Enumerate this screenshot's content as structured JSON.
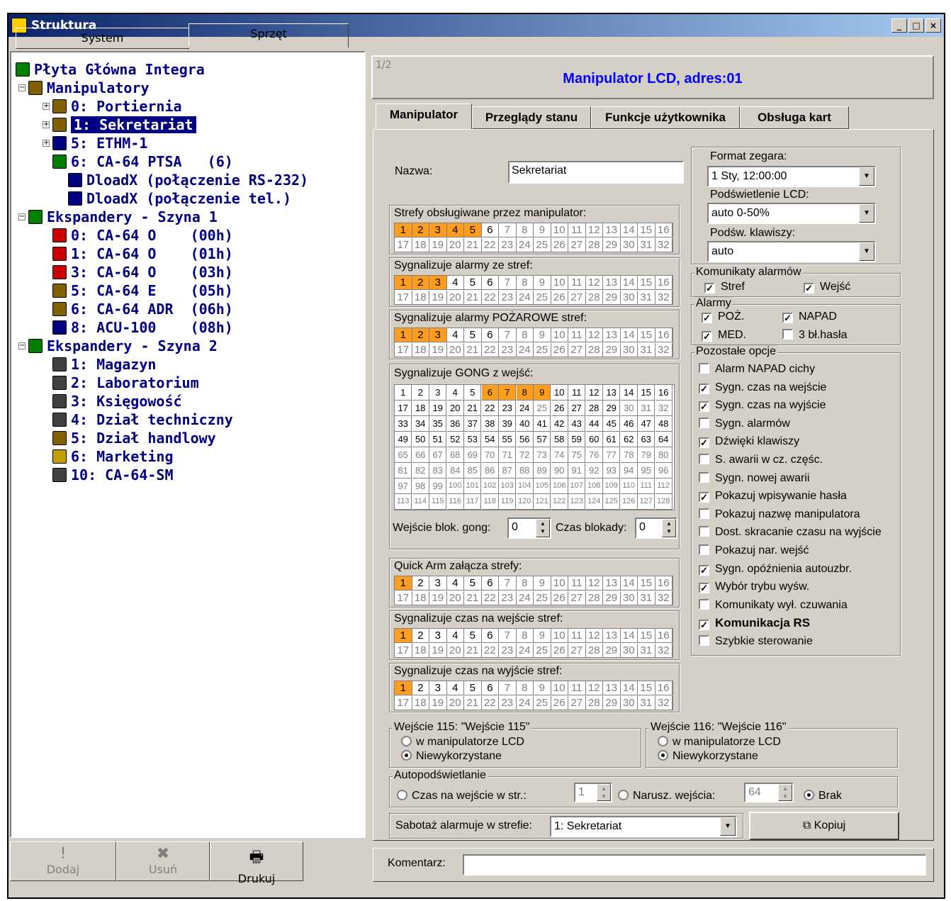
{
  "window": {
    "title": "Struktura",
    "minimize": "_",
    "maximize": "□",
    "close": "×"
  },
  "left_tabs": [
    "System",
    "Sprzęt"
  ],
  "tree": [
    {
      "label": "Płyta Główna Integra",
      "icon": "mainboard-icon"
    },
    {
      "label": "Manipulatory",
      "icon": "keypads-icon"
    },
    {
      "label": "0: Portiernia",
      "icon": "keypad-icon"
    },
    {
      "label": "1: Sekretariat",
      "icon": "keypad-icon"
    },
    {
      "label": "5: ETHM-1",
      "icon": "ethernet-module-icon"
    },
    {
      "label": "6: CA-64 PTSA   (6)",
      "icon": "signal-board-icon"
    },
    {
      "label": "DloadX (połączenie RS-232)",
      "icon": "dloadx-icon"
    },
    {
      "label": "DloadX (połączenie tel.)",
      "icon": "dloadx-icon"
    },
    {
      "label": "Ekspandery - Szyna 1",
      "icon": "expanders-icon"
    },
    {
      "label": "0: CA-64 O    (00h)",
      "icon": "output-expander-icon"
    },
    {
      "label": "1: CA-64 O    (01h)",
      "icon": "output-expander-icon"
    },
    {
      "label": "3: CA-64 O    (03h)",
      "icon": "output-expander-icon"
    },
    {
      "label": "5: CA-64 E    (05h)",
      "icon": "input-expander-icon"
    },
    {
      "label": "6: CA-64 ADR  (06h)",
      "icon": "input-expander-icon"
    },
    {
      "label": "8: ACU-100    (08h)",
      "icon": "wireless-controller-icon"
    },
    {
      "label": "Ekspandery - Szyna 2",
      "icon": "expanders-icon"
    },
    {
      "label": "1: Magazyn",
      "icon": "partition-keypad-icon"
    },
    {
      "label": "2: Laboratorium",
      "icon": "card-reader-icon"
    },
    {
      "label": "3: Księgowość",
      "icon": "partition-keypad-icon"
    },
    {
      "label": "4: Dział techniczny",
      "icon": "card-reader-icon"
    },
    {
      "label": "5: Dział handlowy",
      "icon": "proximity-reader-icon"
    },
    {
      "label": "6: Marketing",
      "icon": "dallas-reader-icon"
    },
    {
      "label": "10: CA-64-SM",
      "icon": "voice-module-icon"
    }
  ],
  "bottom_buttons": {
    "add": "Dodaj",
    "remove": "Usuń",
    "print": "Drukuj"
  },
  "header": {
    "page": "1/2",
    "title": "Manipulator LCD, adres:01"
  },
  "tabs": [
    "Manipulator",
    "Przeglądy stanu",
    "Funkcje użytkownika",
    "Obsługa kart"
  ],
  "form": {
    "name_label": "Nazwa:",
    "name_value": "Sekretariat",
    "zones_handled": {
      "label": "Strefy obsługiwane przez manipulator:",
      "selected": [
        1,
        2,
        3,
        4,
        5
      ],
      "active_max": 6
    },
    "alarms_from": {
      "label": "Sygnalizuje alarmy ze stref:",
      "selected": [
        1,
        2,
        3
      ],
      "active_max": 6
    },
    "fire_alarms": {
      "label": "Sygnalizuje alarmy POŻAROWE stref:",
      "selected": [
        1,
        2,
        3
      ],
      "active_max": 6
    },
    "gong": {
      "label": "Sygnalizuje GONG z wejść:",
      "selected": [
        6,
        7,
        8,
        9
      ]
    },
    "gong_block_label": "Wejście blok. gong:",
    "gong_block_value": "0",
    "block_time_label": "Czas blokady:",
    "block_time_value": "0",
    "quick_arm": {
      "label": "Quick Arm załącza strefy:",
      "selected": [
        1
      ],
      "active_max": 6
    },
    "entry_time": {
      "label": "Sygnalizuje czas na wejście stref:",
      "selected": [
        1
      ],
      "active_max": 6
    },
    "exit_time": {
      "label": "Sygnalizuje czas na wyjście stref:",
      "selected": [
        1
      ],
      "active_max": 6
    },
    "clock_format_label": "Format zegara:",
    "clock_format_value": "1 Sty, 12:00:00",
    "lcd_backlight_label": "Podświetlenie  LCD:",
    "lcd_backlight_value": "auto 0-50%",
    "key_backlight_label": "Podśw. klawiszy:",
    "key_backlight_value": "auto",
    "alarm_messages": {
      "label": "Komunikaty alarmów",
      "stref": "Stref",
      "wejsc": "Wejść"
    },
    "alarms": {
      "label": "Alarmy",
      "poz": "POŻ.",
      "napad": "NAPAD",
      "med": "MED.",
      "hasla": "3 bł.hasła"
    },
    "other_options_label": "Pozostałe opcje",
    "options": [
      {
        "label": "Alarm NAPAD cichy",
        "checked": false
      },
      {
        "label": "Sygn. czas na wejście",
        "checked": true
      },
      {
        "label": "Sygn. czas na wyjście",
        "checked": true
      },
      {
        "label": "Sygn. alarmów",
        "checked": false
      },
      {
        "label": "Dźwięki klawiszy",
        "checked": true
      },
      {
        "label": "S. awarii w cz. częśc.",
        "checked": false
      },
      {
        "label": "Sygn. nowej awarii",
        "checked": false
      },
      {
        "label": "Pokazuj wpisywanie hasła",
        "checked": true
      },
      {
        "label": "Pokazuj nazwę manipulatora",
        "checked": false
      },
      {
        "label": "Dost. skracanie czasu na wyjście",
        "checked": false
      },
      {
        "label": "Pokazuj nar. wejść",
        "checked": false
      },
      {
        "label": "Sygn. opóźnienia autouzbr.",
        "checked": true
      },
      {
        "label": "Wybór trybu wyśw.",
        "checked": true
      },
      {
        "label": "Komunikaty wył. czuwania",
        "checked": false
      },
      {
        "label": "Komunikacja RS",
        "checked": true
      },
      {
        "label": "Szybkie sterowanie",
        "checked": false
      }
    ],
    "input115": {
      "label": "Wejście 115: \"Wejście 115\"",
      "opt1": "w manipulatorze LCD",
      "opt2": "Niewykorzystane"
    },
    "input116": {
      "label": "Wejście 116: \"Wejście 116\"",
      "opt1": "w manipulatorze LCD",
      "opt2": "Niewykorzystane"
    },
    "autobacklight": {
      "label": "Autopodświetlanie",
      "opt1": "Czas na wejście w str.:",
      "val1": "1",
      "opt2": "Narusz. wejścia:",
      "val2": "64",
      "opt3": "Brak"
    },
    "tamper_label": "Sabotaż alarmuje w strefie:",
    "tamper_value": "1: Sekretariat",
    "copy_label": "Kopiuj",
    "comment_label": "Komentarz:",
    "comment_value": ""
  },
  "colors": {
    "selected_cell": "#ff9e1e",
    "title_blue": "#0000ff",
    "tree_text": "#000080"
  }
}
